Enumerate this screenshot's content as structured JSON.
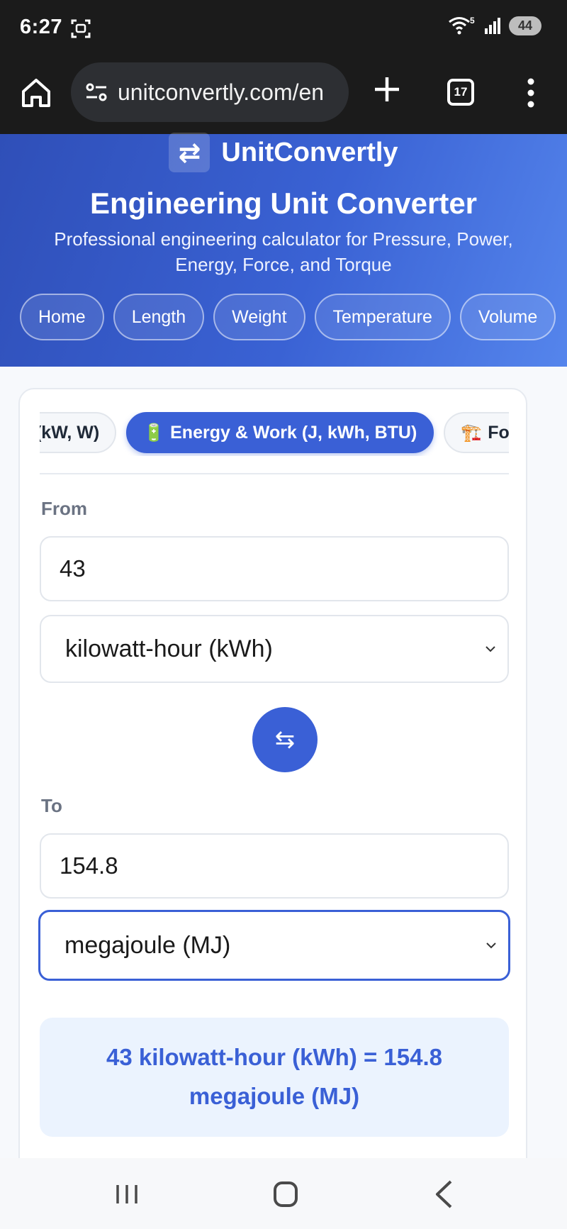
{
  "status_bar": {
    "time": "6:27",
    "battery": "44",
    "wifi_badge": "5",
    "icons": [
      "screenshot-icon",
      "wifi-icon",
      "signal-icon",
      "battery-icon"
    ]
  },
  "browser": {
    "url": "unitconvertly.com/en",
    "tab_count": "17",
    "icons": [
      "home-icon",
      "site-settings-icon",
      "new-tab-icon",
      "tabs-icon",
      "more-menu-icon"
    ]
  },
  "hero": {
    "brand_icon": "⇄",
    "brand_name": "UnitConvertly",
    "title": "Engineering Unit Converter",
    "subtitle": "Professional engineering calculator for Pressure, Power, Energy, Force, and Torque",
    "nav": [
      "Home",
      "Length",
      "Weight",
      "Temperature",
      "Volume"
    ]
  },
  "categories": {
    "items": [
      {
        "emoji": "",
        "label": "Power (kW, W)"
      },
      {
        "emoji": "🔋",
        "label": "Energy & Work (J, kWh, BTU)"
      },
      {
        "emoji": "🏗️",
        "label": "Force"
      }
    ],
    "active_index": 1
  },
  "converter": {
    "from_label": "From",
    "from_value": "43",
    "from_unit": "kilowatt-hour (kWh)",
    "swap_icon": "⇆",
    "to_label": "To",
    "to_value": "154.8",
    "to_unit": "megajoule (MJ)",
    "result": "43 kilowatt-hour (kWh) = 154.8 megajoule (MJ)"
  },
  "colors": {
    "accent": "#3a60d6",
    "result_bg": "#ebf3fe",
    "hero_gradient_start": "#2f4fb8",
    "hero_gradient_end": "#5585ec"
  }
}
